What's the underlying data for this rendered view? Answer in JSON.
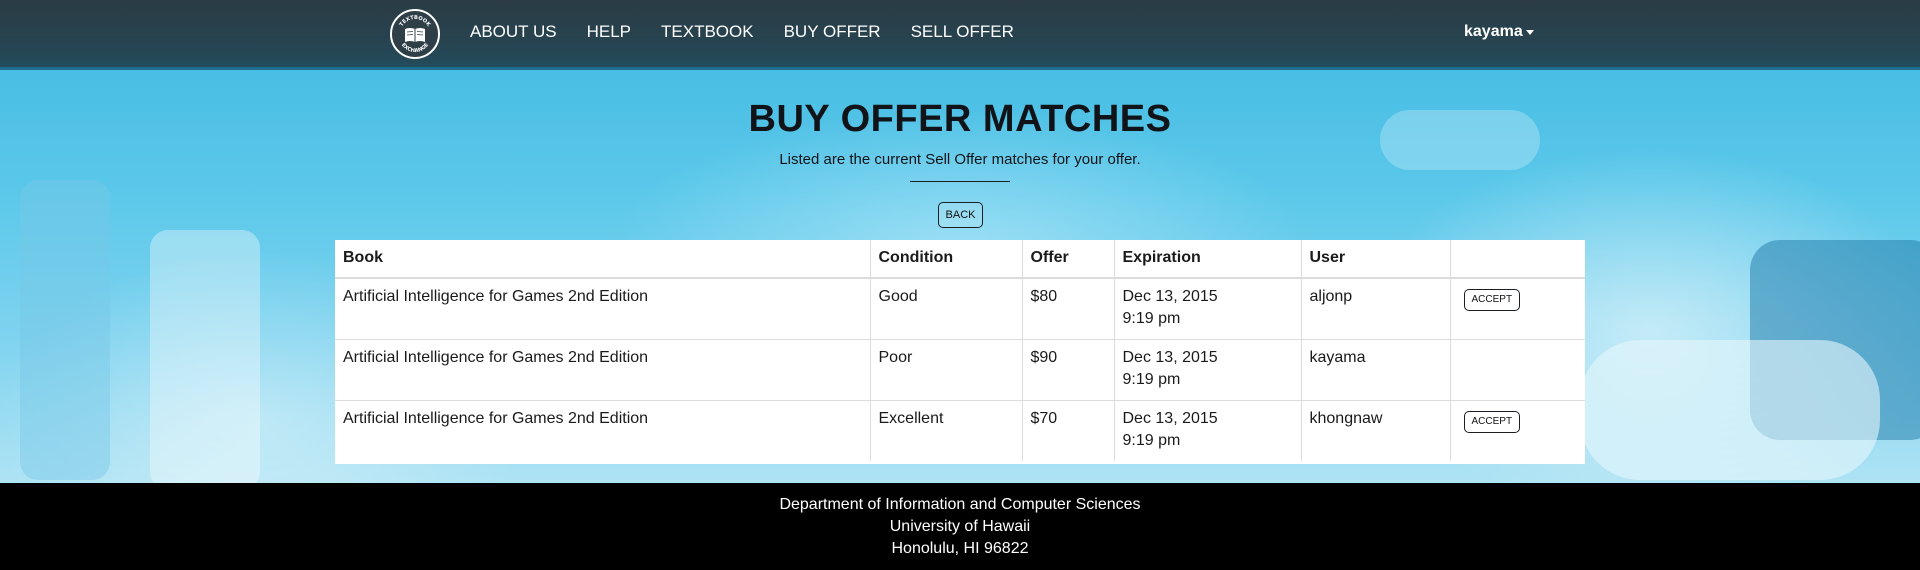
{
  "brand": {
    "logo_icon": "textbook-exchange-logo",
    "logo_text_top": "TEXTBOOK",
    "logo_text_bottom": "EXCHANGE"
  },
  "nav": {
    "links": [
      {
        "label": "ABOUT US"
      },
      {
        "label": "HELP"
      },
      {
        "label": "TEXTBOOK"
      },
      {
        "label": "BUY OFFER"
      },
      {
        "label": "SELL OFFER"
      }
    ],
    "user": "kayama",
    "user_icon": "caret-down-icon"
  },
  "page": {
    "title": "BUY OFFER MATCHES",
    "subtitle": "Listed are the current Sell Offer matches for your offer.",
    "back_label": "BACK"
  },
  "table": {
    "headers": [
      "Book",
      "Condition",
      "Offer",
      "Expiration",
      "User",
      ""
    ],
    "rows": [
      {
        "book": "Artificial Intelligence for Games 2nd Edition",
        "condition": "Good",
        "offer": "$80",
        "exp_date": "Dec 13, 2015",
        "exp_time": "9:19 pm",
        "user": "aljonp",
        "action": "ACCEPT"
      },
      {
        "book": "Artificial Intelligence for Games 2nd Edition",
        "condition": "Poor",
        "offer": "$90",
        "exp_date": "Dec 13, 2015",
        "exp_time": "9:19 pm",
        "user": "kayama",
        "action": ""
      },
      {
        "book": "Artificial Intelligence for Games 2nd Edition",
        "condition": "Excellent",
        "offer": "$70",
        "exp_date": "Dec 13, 2015",
        "exp_time": "9:19 pm",
        "user": "khongnaw",
        "action": "ACCEPT"
      }
    ]
  },
  "footer": {
    "line1": "Department of Information and Computer Sciences",
    "line2": "University of Hawaii",
    "line3": "Honolulu, HI 96822"
  },
  "colors": {
    "navbar": "#2b3c44",
    "hero_blue": "#3fb8e0",
    "footer": "#000000",
    "text": "#101418"
  }
}
